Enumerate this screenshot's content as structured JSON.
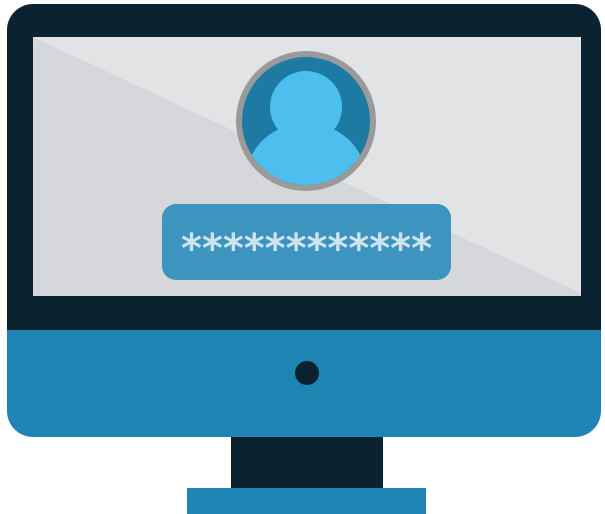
{
  "login_screen": {
    "avatar_icon": "user-avatar-icon",
    "password_mask": "************"
  },
  "colors": {
    "bezel": "#0b2230",
    "chin": "#1e84b4",
    "screen_light": "#e2e3e5",
    "screen_shadow": "#d5d7da",
    "avatar_ring": "#9a9a9a",
    "avatar_bg": "#1c7aa3",
    "avatar_person": "#4cbfee",
    "password_field": "#3d95bf",
    "password_text": "#cfe3ee"
  }
}
